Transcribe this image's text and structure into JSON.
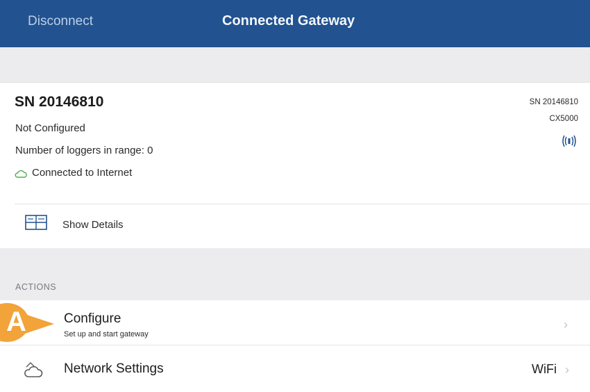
{
  "navbar": {
    "left_button": "Disconnect",
    "title": "Connected Gateway",
    "bg_color": "#22528f"
  },
  "gateway": {
    "title": "SN 20146810",
    "status": "Not Configured",
    "loggers_text": "Number of loggers in range: 0",
    "internet_text": "Connected to Internet",
    "right_sn": "SN 20146810",
    "right_model": "CX5000",
    "signal_icon": "signal-waves-icon",
    "cloud_icon": "cloud-icon"
  },
  "details": {
    "label": "Show Details",
    "icon": "details-panel-icon"
  },
  "actions": {
    "header": "ACTIONS",
    "configure": {
      "title": "Configure",
      "subtitle": "Set up and start gateway",
      "badge": "A"
    },
    "network": {
      "title": "Network Settings",
      "value": "WiFi",
      "icon": "network-cloud-icon"
    }
  },
  "colors": {
    "badge": "#f2a33a",
    "background": "#efeff1"
  }
}
